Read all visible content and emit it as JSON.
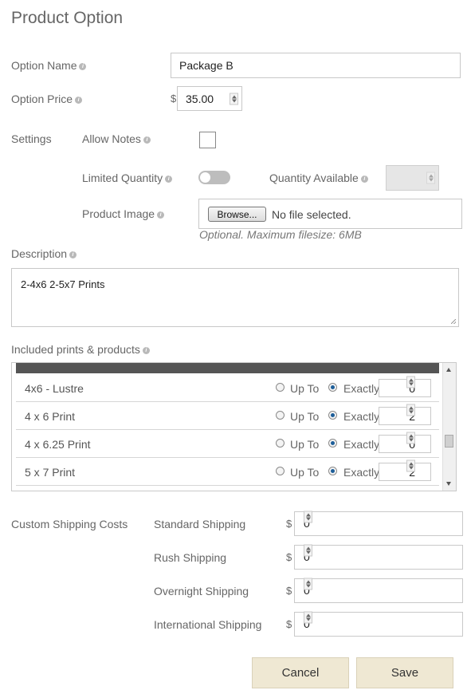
{
  "page": {
    "title": "Product Option"
  },
  "form": {
    "option_name": {
      "label": "Option Name",
      "value": "Package B"
    },
    "option_price": {
      "label": "Option Price",
      "currency": "$",
      "value": "35.00"
    },
    "settings": {
      "label": "Settings",
      "allow_notes": {
        "label": "Allow Notes",
        "checked": false
      },
      "limited_quantity": {
        "label": "Limited Quantity",
        "on": false
      },
      "quantity_available": {
        "label": "Quantity Available",
        "value": ""
      },
      "product_image": {
        "label": "Product Image",
        "browse_label": "Browse...",
        "file_status": "No file selected.",
        "helper": "Optional. Maximum filesize: 6MB"
      }
    },
    "description": {
      "label": "Description",
      "value": "2-4x6 2-5x7 Prints"
    },
    "included": {
      "label": "Included prints & products",
      "up_to_label": "Up To",
      "exactly_label": "Exactly",
      "rows": [
        {
          "name": "4x6 - Lustre",
          "mode": "exactly",
          "qty": "0"
        },
        {
          "name": "4 x 6 Print",
          "mode": "exactly",
          "qty": "2"
        },
        {
          "name": "4 x 6.25 Print",
          "mode": "exactly",
          "qty": "0"
        },
        {
          "name": "5 x 7 Print",
          "mode": "exactly",
          "qty": "2"
        }
      ]
    },
    "shipping": {
      "label": "Custom Shipping Costs",
      "currency": "$",
      "items": [
        {
          "label": "Standard Shipping",
          "value": "0"
        },
        {
          "label": "Rush Shipping",
          "value": "0"
        },
        {
          "label": "Overnight Shipping",
          "value": "0"
        },
        {
          "label": "International Shipping",
          "value": "0"
        }
      ]
    }
  },
  "actions": {
    "cancel_label": "Cancel",
    "save_label": "Save"
  },
  "colors": {
    "button_bg": "#efe8d3",
    "radio_selected": "#1d5e99",
    "header_band": "#555555"
  },
  "icons": {
    "info": "info-icon",
    "spinner": "spinner-icon"
  }
}
